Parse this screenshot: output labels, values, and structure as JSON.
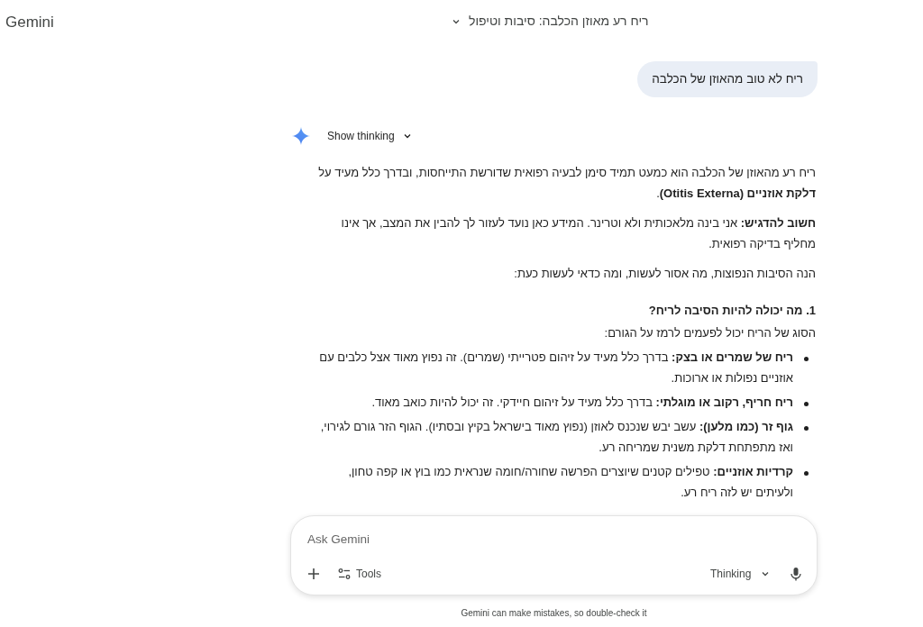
{
  "header": {
    "logo": "Gemini",
    "conversation_title": "ריח רע מאוזן הכלבה: סיבות וטיפול"
  },
  "user_message": "ריח לא טוב מהאוזן של הכלבה",
  "thinking": {
    "label": "Show thinking",
    "expanded": false
  },
  "response": {
    "paragraphs": [
      "ריח רע מהאוזן של הכלבה הוא כמעט תמיד סימן לבעיה רפואית שדורשת התייחסות, ובדרך כלל מעיד על **דלקת אוזניים (Otitis Externa)**.",
      "**חשוב להדגיש:** אני בינה מלאכותית ולא וטרינר. המידע כאן נועד לעזור לך להבין את המצב, אך אינו מחליף בדיקה רפואית.",
      "הנה הסיבות הנפוצות, מה אסור לעשות, ומה כדאי לעשות כעת:"
    ],
    "heading": "1. מה יכולה להיות הסיבה לריח?",
    "intro": "הסוג של הריח יכול לפעמים לרמז על הגורם:",
    "bullets": [
      "**ריח של שמרים או בצק:** בדרך כלל מעיד על זיהום פטרייתי (שמרים). זה נפוץ מאוד אצל כלבים עם אוזניים נפולות או ארוכות.",
      "**ריח חריף, רקוב או מוגלתי:** בדרך כלל מעיד על זיהום חיידקי. זה יכול להיות כואב מאוד.",
      "**גוף זר (כמו מלען):** עשב יבש שנכנס לאוזן (נפוץ מאוד בישראל בקיץ ובסתיו). הגוף הזר גורם לגירוי, ואז מתפתחת דלקת משנית שמריחה רע.",
      "**קרדיות אוזניים:** טפילים קטנים שיוצרים הפרשה שחורה/חומה שנראית כמו בוץ או קפה טחון, ולעיתים יש לזה ריח רע."
    ]
  },
  "composer": {
    "placeholder": "Ask Gemini",
    "tools_label": "Tools",
    "model_label": "Thinking"
  },
  "disclaimer": "Gemini can make mistakes, so double-check it"
}
